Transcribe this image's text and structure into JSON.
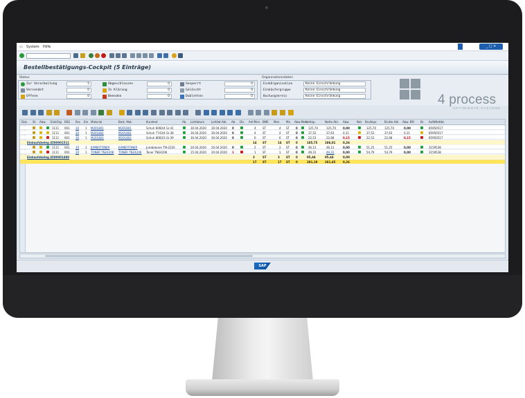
{
  "menu": {
    "system": "System",
    "help": "Hilfe"
  },
  "window": {
    "controls": "_ □ ×"
  },
  "title": "Bestellbestätigungs-Cockpit (5 Einträge)",
  "status_group": {
    "label": "Status",
    "items": [
      {
        "label": "Zur Verarbeitung",
        "value": "5",
        "icon": "traffic-light-icon"
      },
      {
        "label": "Versendet",
        "value": "0",
        "icon": "send-icon"
      },
      {
        "label": "Offene",
        "value": "0",
        "icon": "open-icon"
      },
      {
        "label": "Abgeschlossen",
        "value": "0",
        "icon": "done-icon"
      },
      {
        "label": "In Klärung",
        "value": "0",
        "icon": "clarify-icon"
      },
      {
        "label": "Beenden",
        "value": "0",
        "icon": "end-icon"
      },
      {
        "label": "Gesperrt",
        "value": "0",
        "icon": "lock-icon"
      },
      {
        "label": "Gelöscht",
        "value": "0",
        "icon": "trash-icon"
      },
      {
        "label": "Dubletten",
        "value": "0",
        "icon": "duplicate-icon"
      }
    ]
  },
  "org_group": {
    "label": "Organisationsdaten",
    "items": [
      {
        "label": "EinkOrganisation",
        "value": "Keine Einschränkung"
      },
      {
        "label": "Einkäufergruppe",
        "value": "Keine Einschränkung"
      },
      {
        "label": "Buchungskreis",
        "value": "Keine Einschränkung"
      }
    ]
  },
  "logo": {
    "text": "4 process",
    "sub": "OPTIMIERTE SYSTEME"
  },
  "columns": [
    "Dok.",
    "St.",
    "Abw.",
    "EinkOrg",
    "EKG",
    "Pos",
    "Em",
    "Material",
    "Best. Mat.",
    "Kurztext",
    "Ab.",
    "Liefdatum",
    "Liefdat Abl.",
    "Ab.",
    "Dis.",
    "Anf.Men.",
    "BME",
    "Men.",
    "Me.",
    "Abw.Men.",
    "Nettop.",
    "Netto Abl.",
    "Abw.",
    "Net.",
    "Bruttopr.",
    "Brutto Abl.",
    "Abw. BPr",
    "Br.",
    "AufbNettbt."
  ],
  "rows": [
    {
      "type": "data",
      "st": "y",
      "abw": "g",
      "ekorg": "1111",
      "ekg": "001",
      "pos": "10",
      "em": "1",
      "mat": "M201801",
      "bmat": "M201801",
      "text": "Schuh 6060/4 Gr.41",
      "ab": "g",
      "ldat": "30.04.2020",
      "ldat2": "30.04.2020",
      "ab2": "0",
      "dis": "g",
      "anf": "4",
      "bme": "ST",
      "men": "4",
      "me": "ST",
      "abwm": "0",
      "ampm": "g",
      "netto": "125,70",
      "netto2": "125,70",
      "abwn": "0,00",
      "netl": "g",
      "brutto": "125,70",
      "brutto2": "125,70",
      "abwb": "0,00",
      "brl": "g",
      "auf": "85950517"
    },
    {
      "type": "data",
      "st": "y",
      "abw": "y",
      "ekorg": "1111",
      "ekg": "001",
      "pos": "20",
      "em": "1",
      "mat": "M201802",
      "bmat": "M201802",
      "text": "Schuh 7743/4 Gr.38",
      "ab": "g",
      "ldat": "30.04.2020",
      "ldat2": "30.04.2020",
      "ab2": "0",
      "dis": "g",
      "anf": "4",
      "bme": "ST",
      "men": "4",
      "me": "ST",
      "abwm": "0",
      "ampm": "g",
      "netto": "37,52",
      "netto2": "37,63",
      "abwn": "0,11",
      "netl": "y",
      "brutto": "37,52",
      "brutto2": "37,63",
      "abwb": "0,11",
      "brl": "y",
      "auf": "85950517"
    },
    {
      "type": "data",
      "st": "y",
      "abw": "r",
      "ekorg": "1111",
      "ekg": "001",
      "pos": "30",
      "em": "1",
      "mat": "M201803",
      "bmat": "M201803",
      "text": "Schuh 8083/3 Gr.39",
      "ab": "g",
      "ldat": "30.04.2020",
      "ldat2": "30.04.2020",
      "ab2": "0",
      "dis": "g",
      "anf": "6",
      "bme": "ST",
      "men": "6",
      "me": "ST",
      "abwm": "0",
      "ampm": "g",
      "netto": "22,53",
      "netto2": "22,68",
      "abwn": "0,15",
      "netl": "r",
      "brutto": "22,53",
      "brutto2": "22,68",
      "abwb": "0,15",
      "brl": "r",
      "auf": "85950517"
    },
    {
      "type": "sub",
      "label": "Einkaufsbeleg 4500001511",
      "anf": "14",
      "bme": "ST",
      "men": "14",
      "me": "ST",
      "abwm": "0",
      "netto": "185,75",
      "netto2": "186,01",
      "abwn": "0,26"
    },
    {
      "type": "data",
      "st": "y",
      "abw": "g",
      "ekorg": "1111",
      "ekg": "001",
      "pos": "10",
      "em": "1",
      "mat": "JUMBOTONER",
      "bmat": "JUMBOTONER",
      "text": "Jumbotoner TN-2220",
      "ab": "g",
      "ldat": "20.04.2020",
      "ldat2": "20.04.2020",
      "ab2": "0",
      "dis": "g",
      "anf": "2",
      "bme": "ST",
      "men": "2",
      "me": "ST",
      "abwm": "0",
      "ampm": "g",
      "netto": "46,13",
      "netto2": "46,13",
      "abwn": "0,00",
      "netl": "g",
      "brutto": "51,25",
      "brutto2": "51,25",
      "abwb": "0,00",
      "brl": "g",
      "auf": "3159538"
    },
    {
      "type": "data",
      "st": "y",
      "abw": "r",
      "ekorg": "1111",
      "ekg": "001",
      "pos": "20",
      "em": "1",
      "mat": "TONER TN2420K",
      "bmat": "TONER TN2420K",
      "text": "Toner TN2420K",
      "ab": "g",
      "ldat": "15.04.2020",
      "ldat2": "20.04.2020",
      "ab2": "1",
      "dis": "r",
      "anf": "1",
      "bme": "ST",
      "men": "1",
      "me": "ST",
      "abwm": "0",
      "ampm": "g",
      "netto": "49,31",
      "netto2": "49,31",
      "abwn": "0,00",
      "netl": "g",
      "brutto": "54,79",
      "brutto2": "54,79",
      "abwb": "0,00",
      "brl": "g",
      "auf": "3159538"
    },
    {
      "type": "sub",
      "label": "Einkaufsbeleg 4500001490",
      "anf": "3",
      "bme": "ST",
      "men": "3",
      "me": "ST",
      "abwm": "0",
      "netto": "95,44",
      "netto2": "95,44",
      "abwn": "0,00"
    },
    {
      "type": "total",
      "label": "",
      "anf": "17",
      "bme": "ST",
      "men": "17",
      "me": "ST",
      "abwm": "0",
      "netto": "281,19",
      "netto2": "281,45",
      "abwn": "0,26"
    }
  ],
  "status_bar": {
    "sap": "SAP"
  }
}
